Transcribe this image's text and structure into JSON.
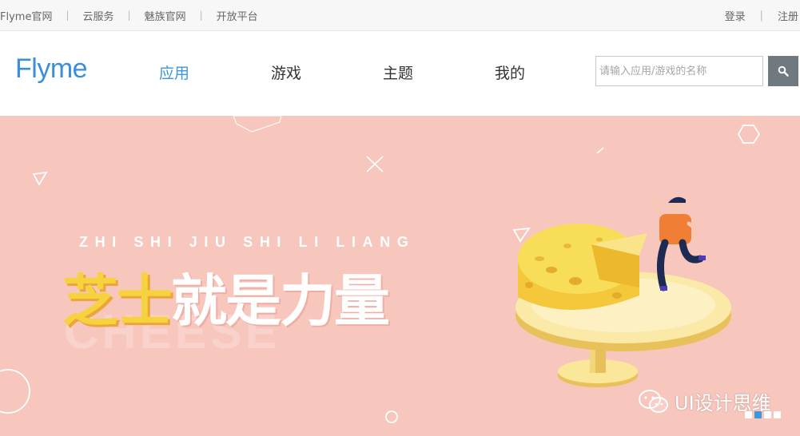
{
  "topbar": {
    "links": [
      "Flyme官网",
      "云服务",
      "魅族官网",
      "开放平台"
    ],
    "login": "登录",
    "register": "注册"
  },
  "header": {
    "logo": "Flyme",
    "nav": [
      "应用",
      "游戏",
      "主题",
      "我的"
    ],
    "active_nav": "应用",
    "search_placeholder": "请输入应用/游戏的名称"
  },
  "banner": {
    "pinyin": "ZHI SHI JIU SHI LI LIANG",
    "title_highlight": "芝士",
    "title_rest": "就是力量",
    "bg_word": "CHEESE",
    "carousel_count": 4,
    "carousel_active": 1
  },
  "watermark": "UI设计思维",
  "colors": {
    "accent": "#3d96de",
    "banner_bg": "#f7c6bd",
    "cheese_yellow": "#f6d23e"
  }
}
